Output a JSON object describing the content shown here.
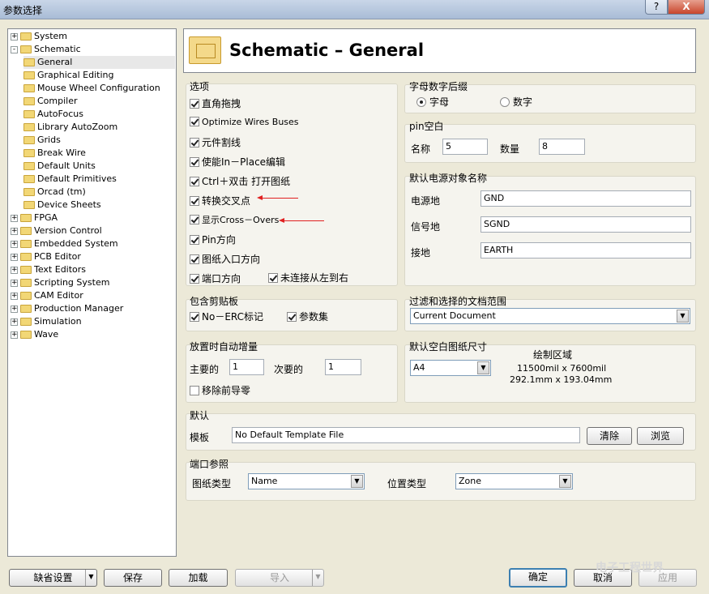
{
  "window": {
    "title": "参数选择",
    "help_label": "?",
    "close_label": "X"
  },
  "tree": [
    {
      "label": "System",
      "level": 0,
      "expander": "+"
    },
    {
      "label": "Schematic",
      "level": 0,
      "expander": "-"
    },
    {
      "label": "General",
      "level": 1,
      "selected": true
    },
    {
      "label": "Graphical Editing",
      "level": 1
    },
    {
      "label": "Mouse Wheel Configuration",
      "level": 1
    },
    {
      "label": "Compiler",
      "level": 1
    },
    {
      "label": "AutoFocus",
      "level": 1
    },
    {
      "label": "Library AutoZoom",
      "level": 1
    },
    {
      "label": "Grids",
      "level": 1
    },
    {
      "label": "Break Wire",
      "level": 1
    },
    {
      "label": "Default Units",
      "level": 1
    },
    {
      "label": "Default Primitives",
      "level": 1
    },
    {
      "label": "Orcad (tm)",
      "level": 1
    },
    {
      "label": "Device Sheets",
      "level": 1
    },
    {
      "label": "FPGA",
      "level": 0,
      "expander": "+"
    },
    {
      "label": "Version Control",
      "level": 0,
      "expander": "+"
    },
    {
      "label": "Embedded System",
      "level": 0,
      "expander": "+"
    },
    {
      "label": "PCB Editor",
      "level": 0,
      "expander": "+"
    },
    {
      "label": "Text Editors",
      "level": 0,
      "expander": "+"
    },
    {
      "label": "Scripting System",
      "level": 0,
      "expander": "+"
    },
    {
      "label": "CAM Editor",
      "level": 0,
      "expander": "+"
    },
    {
      "label": "Production Manager",
      "level": 0,
      "expander": "+"
    },
    {
      "label": "Simulation",
      "level": 0,
      "expander": "+"
    },
    {
      "label": "Wave",
      "level": 0,
      "expander": "+"
    }
  ],
  "header": {
    "title": "Schematic – General"
  },
  "options": {
    "label": "选项",
    "items": [
      {
        "label": "直角拖拽",
        "checked": true
      },
      {
        "label": "Optimize Wires Buses",
        "checked": true
      },
      {
        "label": "元件割线",
        "checked": true
      },
      {
        "label": "使能In－Place编辑",
        "checked": true
      },
      {
        "label": "Ctrl＋双击 打开图纸",
        "checked": true
      },
      {
        "label": "转换交叉点",
        "checked": true
      },
      {
        "label": "显示Cross－Overs",
        "checked": true
      },
      {
        "label": "Pin方向",
        "checked": true
      },
      {
        "label": "图纸入口方向",
        "checked": true
      },
      {
        "label": "端口方向",
        "checked": true
      }
    ],
    "extra": {
      "label": "未连接从左到右",
      "checked": true
    }
  },
  "alnum_suffix": {
    "label": "字母数字后缀",
    "letter": "字母",
    "number": "数字",
    "selected": "letter"
  },
  "pin_margin": {
    "label": "pin空白",
    "name_label": "名称",
    "name_value": "5",
    "number_label": "数量",
    "number_value": "8"
  },
  "power_names": {
    "label": "默认电源对象名称",
    "power_ground_label": "电源地",
    "power_ground_value": "GND",
    "signal_ground_label": "信号地",
    "signal_ground_value": "SGND",
    "earth_label": "接地",
    "earth_value": "EARTH"
  },
  "clipboard": {
    "label": "包含剪贴板",
    "no_erc_label": "No－ERC标记",
    "no_erc_checked": true,
    "params_label": "参数集",
    "params_checked": true
  },
  "filter_scope": {
    "label": "过滤和选择的文档范围",
    "value": "Current Document"
  },
  "auto_increment": {
    "label": "放置时自动增量",
    "primary_label": "主要的",
    "primary_value": "1",
    "secondary_label": "次要的",
    "secondary_value": "1",
    "remove_zeros_label": "移除前导零",
    "remove_zeros_checked": false
  },
  "sheet_size": {
    "label": "默认空白图纸尺寸",
    "value": "A4",
    "draw_area_label": "绘制区域",
    "mil_size": "11500mil x 7600mil",
    "mm_size": "292.1mm x 193.04mm"
  },
  "defaults": {
    "label": "默认",
    "template_label": "模板",
    "template_value": "No Default Template File",
    "clear_label": "清除",
    "browse_label": "浏览"
  },
  "port_ref": {
    "label": "端口参照",
    "sheet_type_label": "图纸类型",
    "sheet_type_value": "Name",
    "location_type_label": "位置类型",
    "location_type_value": "Zone"
  },
  "footer": {
    "defaults_label": "缺省设置",
    "save_label": "保存",
    "load_label": "加载",
    "import_label": "导入",
    "ok_label": "确定",
    "cancel_label": "取消",
    "apply_label": "应用"
  },
  "watermark": "电子工程世界"
}
